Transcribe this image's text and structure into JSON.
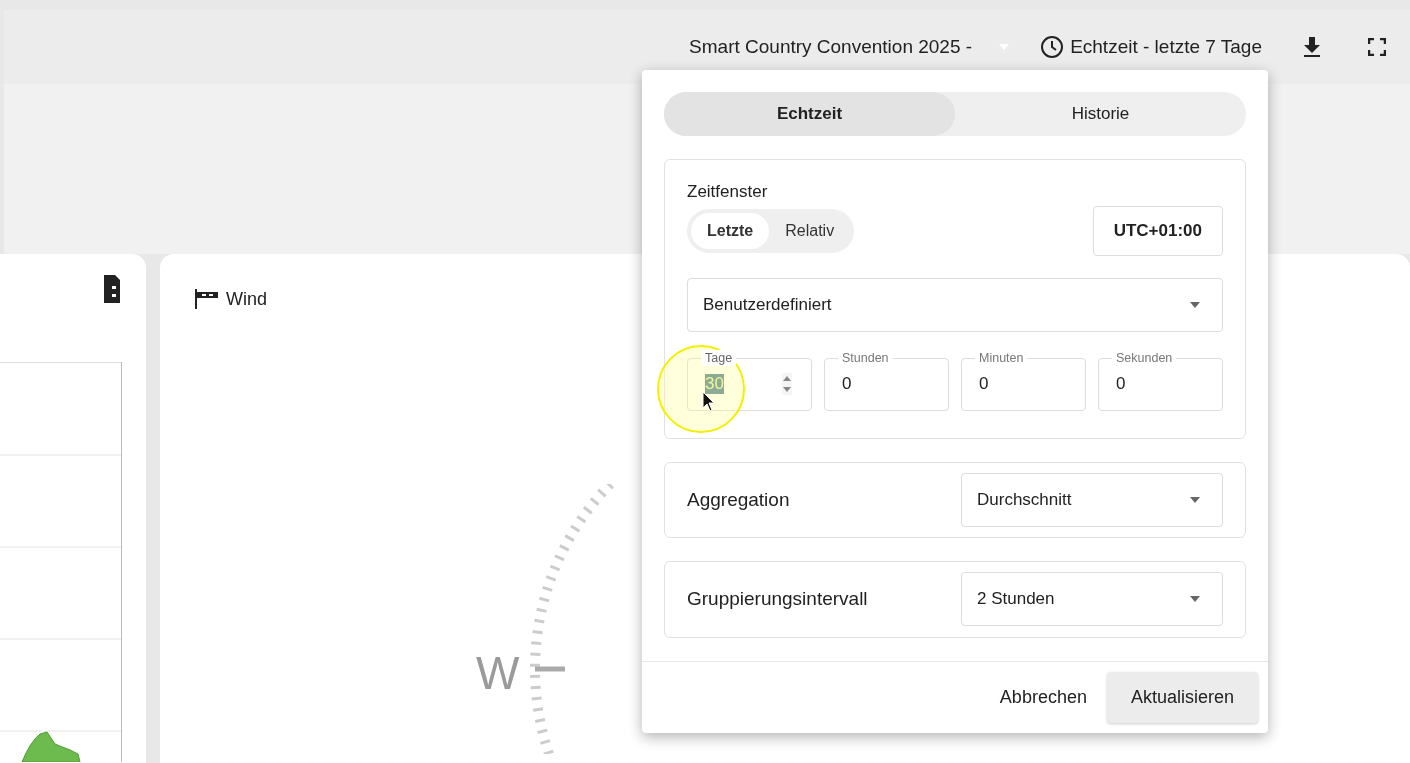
{
  "header": {
    "event_selector": "Smart Country Convention 2025 -",
    "time_range": "Echtzeit - letzte 7 Tage"
  },
  "wind_card": {
    "title": "Wind",
    "compass_label": "W"
  },
  "popup": {
    "tabs": [
      {
        "label": "Echtzeit",
        "selected": true
      },
      {
        "label": "Historie",
        "selected": false
      }
    ],
    "time_window": {
      "title": "Zeitfenster",
      "modes": [
        {
          "label": "Letzte",
          "selected": true
        },
        {
          "label": "Relativ",
          "selected": false
        }
      ],
      "timezone": "UTC+01:00",
      "preset": "Benutzerdefiniert",
      "fields": [
        {
          "label": "Tage",
          "value": "30",
          "kind": "spinner",
          "selected": true
        },
        {
          "label": "Stunden",
          "value": "0",
          "kind": "plain",
          "selected": false
        },
        {
          "label": "Minuten",
          "value": "0",
          "kind": "plain",
          "selected": false
        },
        {
          "label": "Sekunden",
          "value": "0",
          "kind": "plain",
          "selected": false
        }
      ]
    },
    "aggregation": {
      "label": "Aggregation",
      "value": "Durchschnitt"
    },
    "grouping": {
      "label": "Gruppierungsintervall",
      "value": "2 Stunden"
    },
    "buttons": {
      "cancel": "Abbrechen",
      "apply": "Aktualisieren"
    }
  }
}
